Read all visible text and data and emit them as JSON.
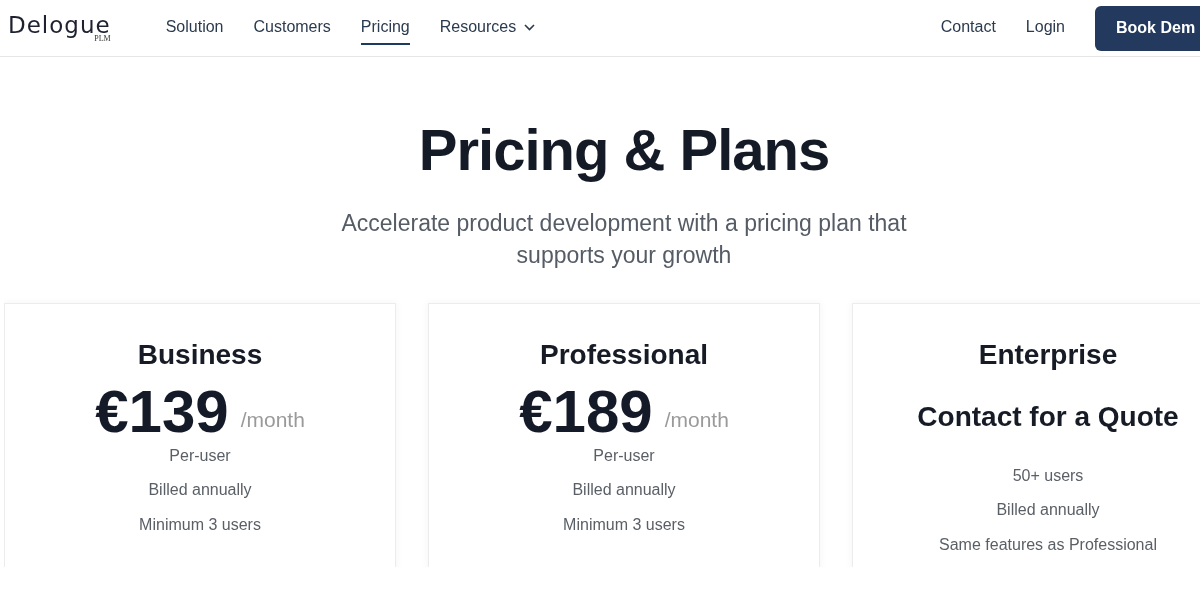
{
  "navbar": {
    "logo": {
      "name": "Delogue",
      "suffix": "PLM"
    },
    "links": [
      {
        "label": "Solution",
        "selected": false,
        "dropdown": false
      },
      {
        "label": "Customers",
        "selected": false,
        "dropdown": false
      },
      {
        "label": "Pricing",
        "selected": true,
        "dropdown": false
      },
      {
        "label": "Resources",
        "selected": false,
        "dropdown": true
      }
    ],
    "right_links": [
      "Contact",
      "Login"
    ],
    "cta": "Book Dem"
  },
  "hero": {
    "title": "Pricing & Plans",
    "subtitle": "Accelerate product development with a pricing plan that supports your growth"
  },
  "plans": [
    {
      "kind": "price",
      "name": "Business",
      "price": "€139",
      "period": "/month",
      "features": [
        "Per-user",
        "Billed annually",
        "Minimum 3 users"
      ]
    },
    {
      "kind": "price",
      "name": "Professional",
      "price": "€189",
      "period": "/month",
      "features": [
        "Per-user",
        "Billed annually",
        "Minimum 3 users"
      ]
    },
    {
      "kind": "quote",
      "name": "Enterprise",
      "quote": "Contact for a Quote",
      "features": [
        "50+ users",
        "Billed annually",
        "Same features as Professional"
      ]
    }
  ]
}
